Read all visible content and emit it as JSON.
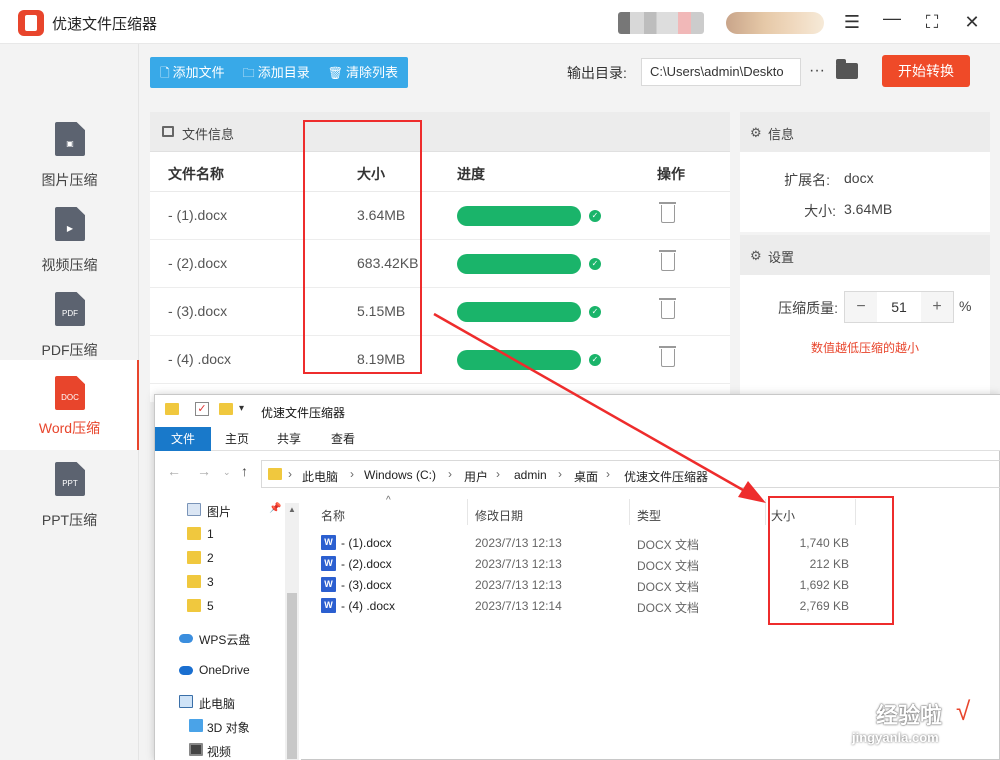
{
  "app": {
    "title": "优速文件压缩器",
    "window_controls": [
      "menu-icon",
      "minimize-icon",
      "maximize-icon",
      "close-icon"
    ]
  },
  "sidebar": {
    "items": [
      {
        "label": "图片压缩",
        "icon": "image-file-icon",
        "badge": ""
      },
      {
        "label": "视频压缩",
        "icon": "video-file-icon",
        "badge": ""
      },
      {
        "label": "PDF压缩",
        "icon": "pdf-file-icon",
        "badge": "PDF"
      },
      {
        "label": "Word压缩",
        "icon": "doc-file-icon",
        "badge": "DOC",
        "active": true
      },
      {
        "label": "PPT压缩",
        "icon": "ppt-file-icon",
        "badge": "PPT"
      }
    ]
  },
  "toolbar": {
    "add_file": "添加文件",
    "add_dir": "添加目录",
    "clear_list": "清除列表",
    "output_label": "输出目录:",
    "output_value": "C:\\Users\\admin\\Deskto",
    "more": "···",
    "start": "开始转换"
  },
  "file_panel": {
    "title": "文件信息",
    "columns": [
      "文件名称",
      "大小",
      "进度",
      "操作"
    ],
    "rows": [
      {
        "name": "- (1).docx",
        "size": "3.64MB",
        "progress": 1.0
      },
      {
        "name": "- (2).docx",
        "size": "683.42KB",
        "progress": 1.0
      },
      {
        "name": "- (3).docx",
        "size": "5.15MB",
        "progress": 1.0
      },
      {
        "name": "- (4) .docx",
        "size": "8.19MB",
        "progress": 1.0
      }
    ]
  },
  "info": {
    "title": "信息",
    "ext_label": "扩展名:",
    "ext_value": "docx",
    "size_label": "大小:",
    "size_value": "3.64MB"
  },
  "settings": {
    "title": "设置",
    "quality_label": "压缩质量:",
    "quality_value": "51",
    "minus": "−",
    "plus": "+",
    "unit": "%",
    "hint": "数值越低压缩的越小"
  },
  "explorer": {
    "title": "优速文件压缩器",
    "ribbon_tabs": [
      "文件",
      "主页",
      "共享",
      "查看"
    ],
    "breadcrumb": [
      "此电脑",
      "Windows (C:)",
      "用户",
      "admin",
      "桌面",
      "优速文件压缩器"
    ],
    "nav_items": [
      {
        "label": "图片",
        "icon": "pictures-icon",
        "pinned": true
      },
      {
        "label": "1",
        "icon": "folder-icon"
      },
      {
        "label": "2",
        "icon": "folder-icon"
      },
      {
        "label": "3",
        "icon": "folder-icon"
      },
      {
        "label": "5",
        "icon": "folder-icon"
      },
      {
        "label": "WPS云盘",
        "icon": "cloud-icon"
      },
      {
        "label": "OneDrive",
        "icon": "onedrive-icon"
      },
      {
        "label": "此电脑",
        "icon": "computer-icon"
      },
      {
        "label": "3D 对象",
        "icon": "3d-objects-icon"
      },
      {
        "label": "视频",
        "icon": "video-icon"
      }
    ],
    "columns": [
      "名称",
      "修改日期",
      "类型",
      "大小"
    ],
    "files": [
      {
        "name": "- (1).docx",
        "date": "2023/7/13 12:13",
        "type": "DOCX 文档",
        "size": "1,740 KB"
      },
      {
        "name": "- (2).docx",
        "date": "2023/7/13 12:13",
        "type": "DOCX 文档",
        "size": "212 KB"
      },
      {
        "name": "- (3).docx",
        "date": "2023/7/13 12:13",
        "type": "DOCX 文档",
        "size": "1,692 KB"
      },
      {
        "name": "- (4) .docx",
        "date": "2023/7/13 12:14",
        "type": "DOCX 文档",
        "size": "2,769 KB"
      }
    ]
  },
  "annotation_color": "#ee2c2c",
  "accent_color": "#e8452c",
  "progress_color": "#1ab46a",
  "watermark": {
    "logo": "经验啦",
    "url": "jingyanla.com",
    "check": "√"
  }
}
